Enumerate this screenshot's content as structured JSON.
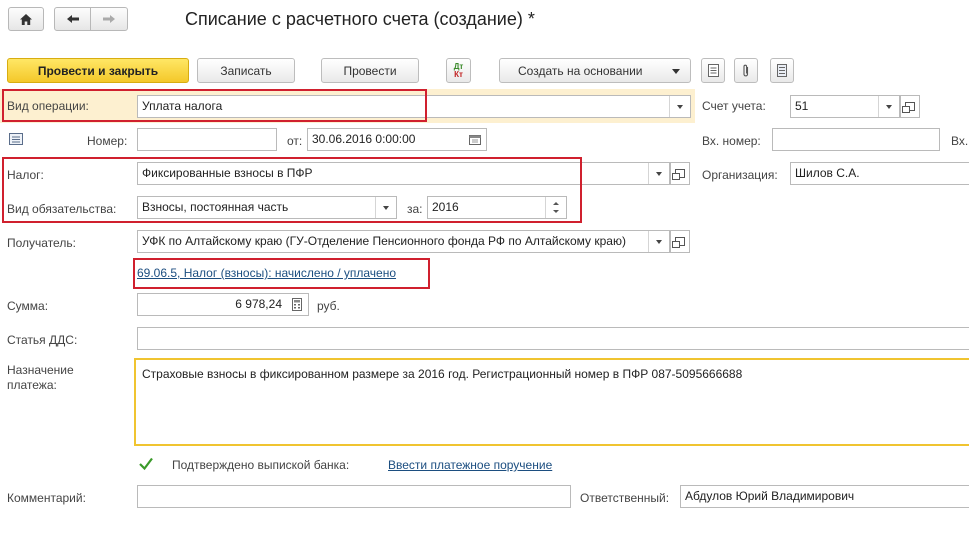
{
  "header": {
    "title": "Списание с расчетного счета (создание) *"
  },
  "toolbar": {
    "post_close": "Провести и закрыть",
    "write": "Записать",
    "post": "Провести",
    "dtkt_top": "Дт",
    "dtkt_bottom": "Кт",
    "create_based": "Создать на основании"
  },
  "form": {
    "operation": {
      "label": "Вид операции:",
      "value": "Уплата налога"
    },
    "account": {
      "label": "Счет учета:",
      "value": "51"
    },
    "number": {
      "label": "Номер:",
      "value": ""
    },
    "date": {
      "label": "от:",
      "value": "30.06.2016  0:00:00"
    },
    "in_number": {
      "label": "Вх. номер:",
      "value": ""
    },
    "in_date": {
      "label": "Вх."
    },
    "tax": {
      "label": "Налог:",
      "value": "Фиксированные взносы в ПФР"
    },
    "organization": {
      "label": "Организация:",
      "value": "Шилов С.А."
    },
    "obligation": {
      "label": "Вид обязательства:",
      "value": "Взносы, постоянная часть"
    },
    "year": {
      "label": "за:",
      "value": "2016"
    },
    "recipient": {
      "label": "Получатель:",
      "value": "УФК по Алтайскому краю (ГУ-Отделение Пенсионного фонда РФ по Алтайскому краю)"
    },
    "account_link": "69.06.5, Налог (взносы): начислено / уплачено",
    "amount": {
      "label": "Сумма:",
      "value": "6 978,24",
      "currency": "руб."
    },
    "dds": {
      "label": "Статья ДДС:",
      "value": ""
    },
    "purpose": {
      "label_line1": "Назначение",
      "label_line2": "платежа:",
      "value": "Страховые взносы в фиксированном размере за 2016 год. Регистрационный номер в ПФР 087-5095666688"
    },
    "confirmed": {
      "label": "Подтверждено выпиской банка:",
      "checked": true
    },
    "payment_order_link": "Ввести платежное поручение",
    "comment": {
      "label": "Комментарий:",
      "value": ""
    },
    "responsible": {
      "label": "Ответственный:",
      "value": "Абдулов Юрий Владимирович"
    }
  },
  "colors": {
    "highlight": "#d0202e",
    "primary_button": "#f4c82a",
    "link": "#1c4e80",
    "check": "#3a9a2a"
  }
}
